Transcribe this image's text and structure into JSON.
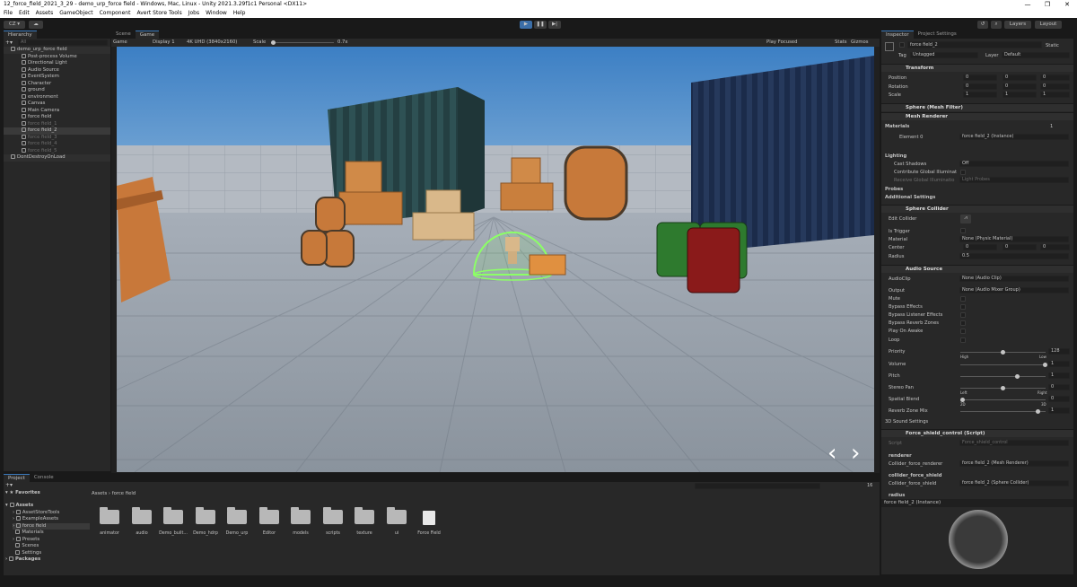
{
  "window": {
    "title": "12_force_field_2021_3_29 - demo_urp_force field - Windows, Mac, Linux - Unity 2021.3.29f1c1 Personal <DX11>",
    "controls": [
      "—",
      "❐",
      "✕"
    ]
  },
  "menu": [
    "File",
    "Edit",
    "Assets",
    "GameObject",
    "Component",
    "Avert Store Tools",
    "Jobs",
    "Window",
    "Help"
  ],
  "toolbar": {
    "account": "CZ ▾",
    "layers": "Layers",
    "layout": "Layout"
  },
  "hierarchy": {
    "tab": "Hierarchy",
    "search_placeholder": "All",
    "items": [
      {
        "label": "demo_urp_force field",
        "indent": 0,
        "state": "scene"
      },
      {
        "label": "Post-process Volume",
        "indent": 1,
        "state": "normal"
      },
      {
        "label": "Directional Light",
        "indent": 1,
        "state": "normal"
      },
      {
        "label": "Audio Source",
        "indent": 1,
        "state": "normal"
      },
      {
        "label": "EventSystem",
        "indent": 1,
        "state": "normal"
      },
      {
        "label": "Character",
        "indent": 1,
        "state": "normal"
      },
      {
        "label": "ground",
        "indent": 1,
        "state": "normal"
      },
      {
        "label": "environment",
        "indent": 1,
        "state": "normal"
      },
      {
        "label": "Canvas",
        "indent": 1,
        "state": "normal"
      },
      {
        "label": "Main Camera",
        "indent": 1,
        "state": "normal"
      },
      {
        "label": "force field",
        "indent": 1,
        "state": "normal"
      },
      {
        "label": "force field_1",
        "indent": 1,
        "state": "dim"
      },
      {
        "label": "force field_2",
        "indent": 1,
        "state": "selected"
      },
      {
        "label": "force field_3",
        "indent": 1,
        "state": "dim"
      },
      {
        "label": "force field_4",
        "indent": 1,
        "state": "dim"
      },
      {
        "label": "force field_5",
        "indent": 1,
        "state": "dim"
      },
      {
        "label": "DontDestroyOnLoad",
        "indent": 0,
        "state": "scene"
      }
    ]
  },
  "game_view": {
    "tabs": [
      "Scene",
      "Game"
    ],
    "display_mode": "Game",
    "display": "Display 1",
    "resolution": "4K UHD (3840x2160)",
    "scale_label": "Scale",
    "scale_value": "0.7x",
    "play_mode": "Play Focused",
    "stats": "Stats",
    "gizmos": "Gizmos",
    "nav_prev": "‹",
    "nav_next": "›"
  },
  "project": {
    "tabs": [
      "Project",
      "Console"
    ],
    "favorites_label": "Favorites",
    "assets_label": "Assets",
    "tree": [
      "AssetStoreTools",
      "ExampleAssets",
      "force field",
      "Materials",
      "Presets",
      "Scenes",
      "Settings"
    ],
    "packages_label": "Packages",
    "breadcrumb": "Assets › force field",
    "item_count": "16",
    "items": [
      "animator",
      "audio",
      "Demo_built...",
      "Demo_hdrp",
      "Demo_urp",
      "Editor",
      "models",
      "scripts",
      "texture",
      "ui",
      "Force Field"
    ]
  },
  "inspector": {
    "tabs": [
      "Inspector",
      "Project Settings"
    ],
    "object_name": "force field_2",
    "static_label": "Static",
    "tag_label": "Tag",
    "tag_value": "Untagged",
    "layer_label": "Layer",
    "layer_value": "Default",
    "transform": {
      "title": "Transform",
      "position_label": "Position",
      "position": [
        "0",
        "0",
        "0"
      ],
      "rotation_label": "Rotation",
      "rotation": [
        "0",
        "0",
        "0"
      ],
      "scale_label": "Scale",
      "scale": [
        "1",
        "1",
        "1"
      ]
    },
    "mesh_filter": "Sphere (Mesh Filter)",
    "mesh_renderer": {
      "title": "Mesh Renderer",
      "materials_label": "Materials",
      "materials_count": "1",
      "element0_label": "Element 0",
      "element0_value": "force field_2 (Instance)",
      "lighting_label": "Lighting",
      "cast_shadows_label": "Cast Shadows",
      "cast_shadows_value": "Off",
      "contribute_gi_label": "Contribute Global Illuminat",
      "receive_gi_label": "Receive Global Illuminatio",
      "receive_gi_value": "Light Probes",
      "probes_label": "Probes",
      "additional_label": "Additional Settings"
    },
    "sphere_collider": {
      "title": "Sphere Collider",
      "edit_label": "Edit Collider",
      "trigger_label": "Is Trigger",
      "material_label": "Material",
      "material_value": "None (Physic Material)",
      "center_label": "Center",
      "center": [
        "0",
        "0",
        "0"
      ],
      "radius_label": "Radius",
      "radius_value": "0.5"
    },
    "audio_source": {
      "title": "Audio Source",
      "clip_label": "AudioClip",
      "clip_value": "None (Audio Clip)",
      "output_label": "Output",
      "output_value": "None (Audio Mixer Group)",
      "toggles": [
        "Mute",
        "Bypass Effects",
        "Bypass Listener Effects",
        "Bypass Reverb Zones",
        "Play On Awake",
        "Loop"
      ],
      "priority_label": "Priority",
      "priority_value": "128",
      "priority_high": "High",
      "priority_low": "Low",
      "volume_label": "Volume",
      "volume_value": "1",
      "pitch_label": "Pitch",
      "pitch_value": "1",
      "stereo_label": "Stereo Pan",
      "stereo_value": "0",
      "stereo_left": "Left",
      "stereo_right": "Right",
      "spatial_label": "Spatial Blend",
      "spatial_value": "0",
      "spatial_2d": "2D",
      "spatial_3d": "3D",
      "reverb_label": "Reverb Zone Mix",
      "reverb_value": "1",
      "sound3d_label": "3D Sound Settings"
    },
    "script": {
      "title": "Force_shield_control (Script)",
      "script_label": "Script",
      "script_value": "Force_shield_control",
      "renderer_header": "renderer",
      "renderer_label": "Collider_force_renderer",
      "renderer_value": "force field_2 (Mesh Renderer)",
      "shield_header": "collider_force_shield",
      "shield_label": "Collider_force_shield",
      "shield_value": "force field_2 (Sphere Collider)",
      "radius_header": "radius"
    },
    "preview_title": "force field_2 (Instance)"
  }
}
